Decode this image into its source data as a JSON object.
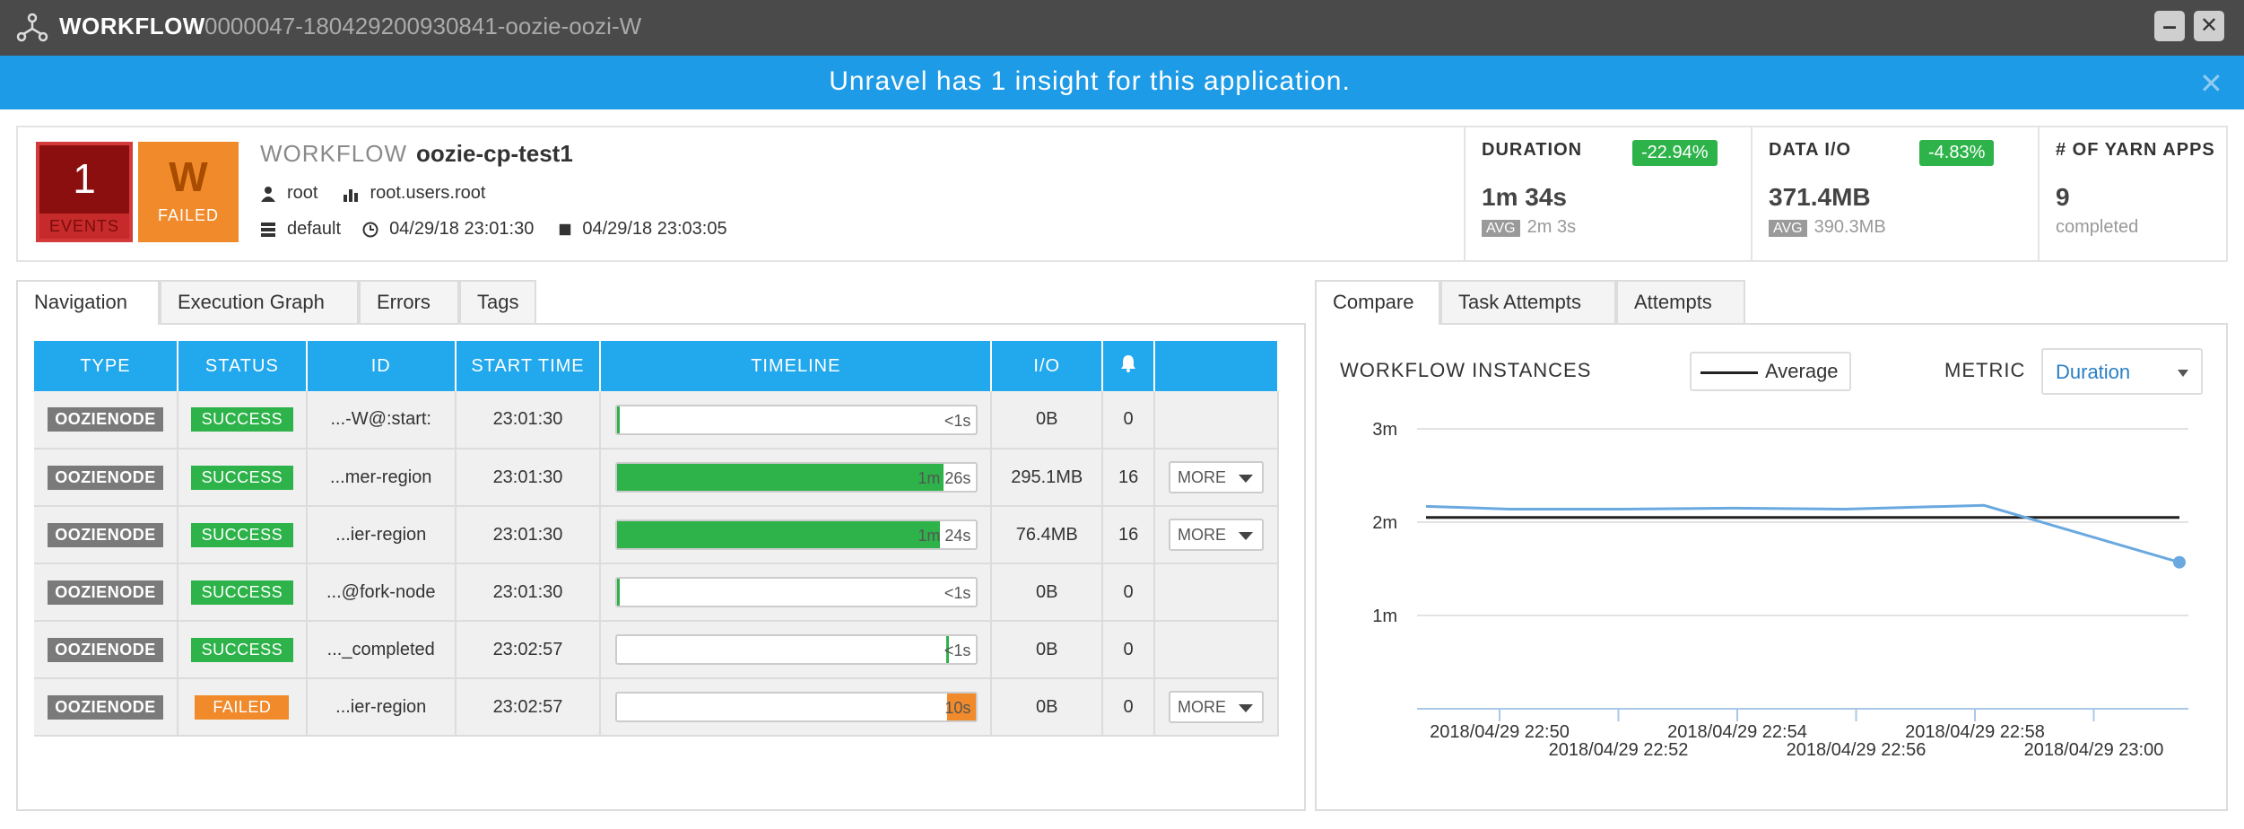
{
  "titlebar": {
    "label": "WORKFLOW",
    "id": "0000047-180429200930841-oozie-oozi-W",
    "minimize_glyph": "–",
    "close_glyph": "✕"
  },
  "banner": {
    "message": "Unravel has 1 insight for this application.",
    "close_glyph": "✕"
  },
  "summary": {
    "events_count": "1",
    "events_label": "EVENTS",
    "status_letter": "W",
    "status_label": "FAILED",
    "type_label": "WORKFLOW",
    "name": "oozie-cp-test1",
    "user": "root",
    "queue": "root.users.root",
    "cluster": "default",
    "start_time": "04/29/18 23:01:30",
    "end_time": "04/29/18 23:03:05"
  },
  "metrics": {
    "duration": {
      "label": "DURATION",
      "change": "-22.94%",
      "value": "1m 34s",
      "avg_tag": "AVG",
      "avg_value": "2m 3s"
    },
    "data_io": {
      "label": "DATA I/O",
      "change": "-4.83%",
      "value": "371.4MB",
      "avg_tag": "AVG",
      "avg_value": "390.3MB"
    },
    "yarn_apps": {
      "label": "# OF YARN APPS",
      "value": "9",
      "sub": "completed"
    }
  },
  "left_tabs": [
    "Navigation",
    "Execution Graph",
    "Errors",
    "Tags"
  ],
  "right_tabs": [
    "Compare",
    "Task Attempts",
    "Attempts"
  ],
  "table": {
    "headers": [
      "TYPE",
      "STATUS",
      "ID",
      "START TIME",
      "TIMELINE",
      "I/O"
    ],
    "bell_icon": "bell-icon",
    "rows": [
      {
        "type": "OOZIENODE",
        "status": "SUCCESS",
        "status_kind": "ok",
        "id": "...-W@:start:",
        "start": "23:01:30",
        "timeline": "<1s",
        "fill_fraction": 0.0,
        "fill_color": "#2db34a",
        "io": "0B",
        "alerts": "0",
        "more": ""
      },
      {
        "type": "OOZIENODE",
        "status": "SUCCESS",
        "status_kind": "ok",
        "id": "...mer-region",
        "start": "23:01:30",
        "timeline": "1m 26s",
        "fill_fraction": 0.91,
        "fill_color": "#2db34a",
        "io": "295.1MB",
        "alerts": "16",
        "more": "MORE"
      },
      {
        "type": "OOZIENODE",
        "status": "SUCCESS",
        "status_kind": "ok",
        "id": "...ier-region",
        "start": "23:01:30",
        "timeline": "1m 24s",
        "fill_fraction": 0.9,
        "fill_color": "#2db34a",
        "io": "76.4MB",
        "alerts": "16",
        "more": "MORE"
      },
      {
        "type": "OOZIENODE",
        "status": "SUCCESS",
        "status_kind": "ok",
        "id": "...@fork-node",
        "start": "23:01:30",
        "timeline": "<1s",
        "fill_fraction": 0.0,
        "fill_color": "#2db34a",
        "io": "0B",
        "alerts": "0",
        "more": ""
      },
      {
        "type": "OOZIENODE",
        "status": "SUCCESS",
        "status_kind": "ok",
        "id": "..._completed",
        "start": "23:02:57",
        "timeline": "<1s",
        "fill_fraction": 0.0,
        "fill_color": "#2db34a",
        "io": "0B",
        "alerts": "0",
        "more": ""
      },
      {
        "type": "OOZIENODE",
        "status": "FAILED",
        "status_kind": "fail",
        "id": "...ier-region",
        "start": "23:02:57",
        "timeline": "10s",
        "fill_fraction": 0.08,
        "fill_color": "#f08a2a",
        "io": "0B",
        "alerts": "0",
        "more": "MORE"
      }
    ]
  },
  "compare": {
    "title": "WORKFLOW INSTANCES",
    "legend_label": "Average",
    "metric_label": "METRIC",
    "metric_value": "Duration"
  },
  "chart_data": {
    "type": "line",
    "title": "WORKFLOW INSTANCES",
    "xlabel": "",
    "ylabel": "",
    "y_unit": "minutes",
    "ylim": [
      0,
      3
    ],
    "y_ticks": [
      {
        "value": 1,
        "label": "1m"
      },
      {
        "value": 2,
        "label": "2m"
      },
      {
        "value": 3,
        "label": "3m"
      }
    ],
    "x_ticks": [
      "2018/04/29 22:50",
      "2018/04/29 22:52",
      "2018/04/29 22:54",
      "2018/04/29 22:56",
      "2018/04/29 22:58",
      "2018/04/29 23:00"
    ],
    "x_range_minutes": [
      22.5,
      36.0
    ],
    "series": [
      {
        "name": "Duration",
        "color": "#6aa9e0",
        "points": [
          {
            "t": 22.5,
            "v": 2.17
          },
          {
            "t": 24.0,
            "v": 2.14
          },
          {
            "t": 26.0,
            "v": 2.14
          },
          {
            "t": 28.0,
            "v": 2.15
          },
          {
            "t": 30.0,
            "v": 2.14
          },
          {
            "t": 32.5,
            "v": 2.18
          },
          {
            "t": 36.0,
            "v": 1.57
          }
        ]
      }
    ],
    "average": {
      "name": "Average",
      "value": 2.05,
      "color": "#222222"
    },
    "grid": true,
    "legend": "top"
  }
}
